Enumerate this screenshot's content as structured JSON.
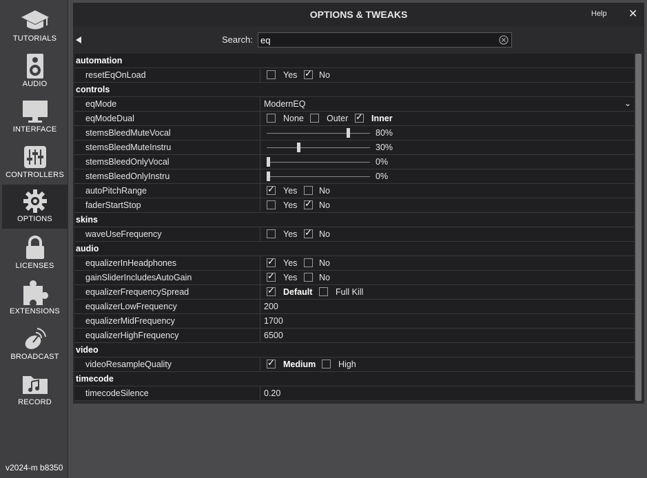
{
  "sidebar": {
    "items": [
      {
        "label": "TUTORIALS",
        "icon": "graduation-cap-icon"
      },
      {
        "label": "AUDIO",
        "icon": "speaker-icon"
      },
      {
        "label": "INTERFACE",
        "icon": "monitor-icon"
      },
      {
        "label": "CONTROLLERS",
        "icon": "sliders-icon"
      },
      {
        "label": "OPTIONS",
        "icon": "gear-icon",
        "active": true
      },
      {
        "label": "LICENSES",
        "icon": "lock-icon"
      },
      {
        "label": "EXTENSIONS",
        "icon": "puzzle-icon"
      },
      {
        "label": "BROADCAST",
        "icon": "satellite-dish-icon"
      },
      {
        "label": "RECORD",
        "icon": "music-folder-icon"
      }
    ],
    "version": "v2024-m b8350"
  },
  "header": {
    "title": "OPTIONS & TWEAKS",
    "help": "Help",
    "close": "✕"
  },
  "search": {
    "label": "Search:",
    "value": "eq"
  },
  "groups": {
    "automation": "automation",
    "controls": "controls",
    "skins": "skins",
    "audio": "audio",
    "video": "video",
    "timecode": "timecode"
  },
  "options": {
    "resetEqOnLoad": {
      "name": "resetEqOnLoad",
      "yes": "Yes",
      "no": "No",
      "value": "No"
    },
    "eqMode": {
      "name": "eqMode",
      "value": "ModernEQ"
    },
    "eqModeDual": {
      "name": "eqModeDual",
      "none": "None",
      "outer": "Outer",
      "inner": "Inner",
      "value": "Inner"
    },
    "stemsBleedMuteVocal": {
      "name": "stemsBleedMuteVocal",
      "label": "80%",
      "percent": 80
    },
    "stemsBleedMuteInstru": {
      "name": "stemsBleedMuteInstru",
      "label": "30%",
      "percent": 30
    },
    "stemsBleedOnlyVocal": {
      "name": "stemsBleedOnlyVocal",
      "label": "0%",
      "percent": 0
    },
    "stemsBleedOnlyInstru": {
      "name": "stemsBleedOnlyInstru",
      "label": "0%",
      "percent": 0
    },
    "autoPitchRange": {
      "name": "autoPitchRange",
      "yes": "Yes",
      "no": "No",
      "value": "Yes"
    },
    "faderStartStop": {
      "name": "faderStartStop",
      "yes": "Yes",
      "no": "No",
      "value": "No"
    },
    "waveUseFrequency": {
      "name": "waveUseFrequency",
      "yes": "Yes",
      "no": "No",
      "value": "No"
    },
    "equalizerInHeadphones": {
      "name": "equalizerInHeadphones",
      "yes": "Yes",
      "no": "No",
      "value": "Yes"
    },
    "gainSliderIncludesAutoGain": {
      "name": "gainSliderIncludesAutoGain",
      "yes": "Yes",
      "no": "No",
      "value": "Yes"
    },
    "equalizerFrequencySpread": {
      "name": "equalizerFrequencySpread",
      "default": "Default",
      "fullkill": "Full Kill",
      "value": "Default"
    },
    "equalizerLowFrequency": {
      "name": "equalizerLowFrequency",
      "value": "200"
    },
    "equalizerMidFrequency": {
      "name": "equalizerMidFrequency",
      "value": "1700"
    },
    "equalizerHighFrequency": {
      "name": "equalizerHighFrequency",
      "value": "6500"
    },
    "videoResampleQuality": {
      "name": "videoResampleQuality",
      "medium": "Medium",
      "high": "High",
      "value": "Medium"
    },
    "timecodeSilence": {
      "name": "timecodeSilence",
      "value": "0.20"
    }
  }
}
